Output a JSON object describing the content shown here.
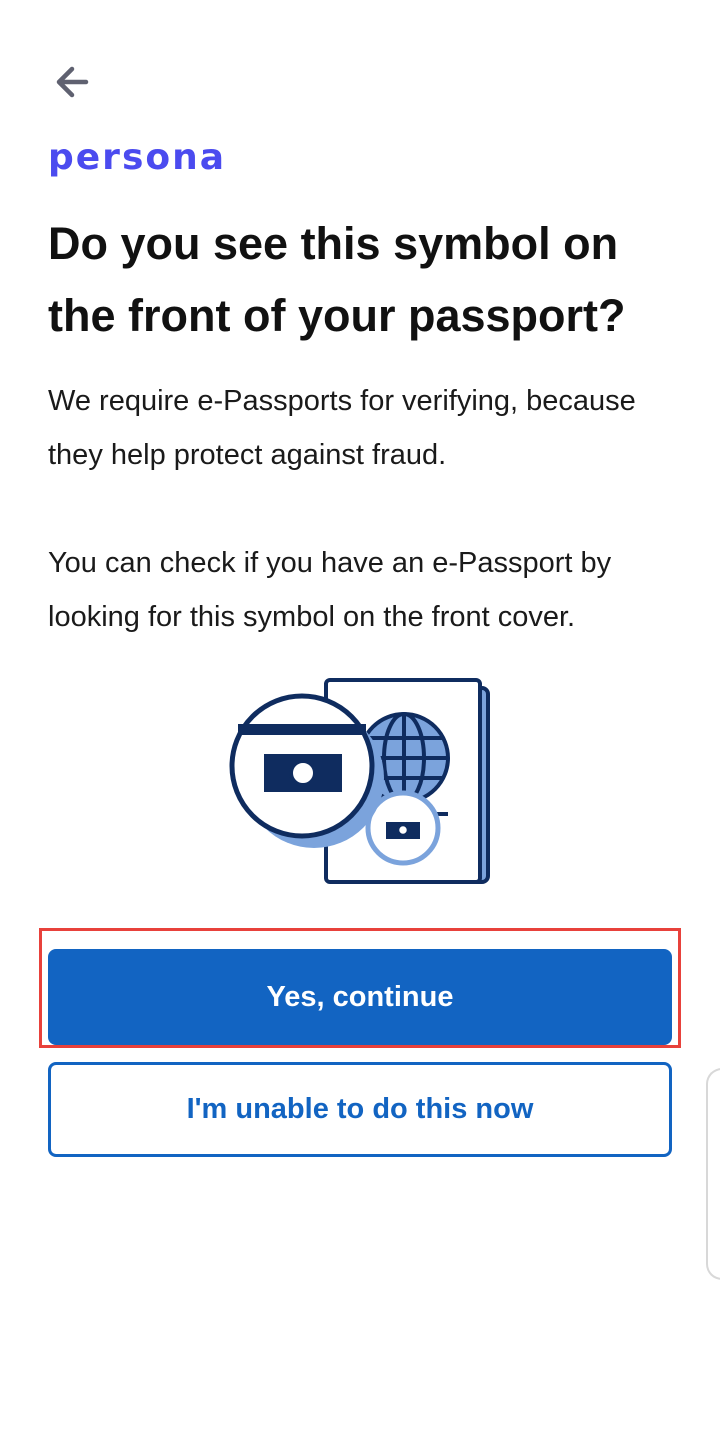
{
  "header": {
    "back_icon": "arrow-left-icon",
    "logo_text": "persona"
  },
  "content": {
    "title": "Do you see this symbol on the front of your passport?",
    "paragraph_1": "We require e-Passports for verifying, because they help protect against fraud.",
    "paragraph_2": "You can check if you have an e-Passport by looking for this symbol on the front cover.",
    "illustration": "e-passport-symbol-illustration"
  },
  "actions": {
    "primary_label": "Yes, continue",
    "secondary_label": "I'm unable to do this now"
  },
  "colors": {
    "brand": "#4b4bef",
    "accent": "#1264c2",
    "navy": "#0f2c5f",
    "light_blue": "#7ba3dc",
    "highlight": "#e8413b"
  }
}
